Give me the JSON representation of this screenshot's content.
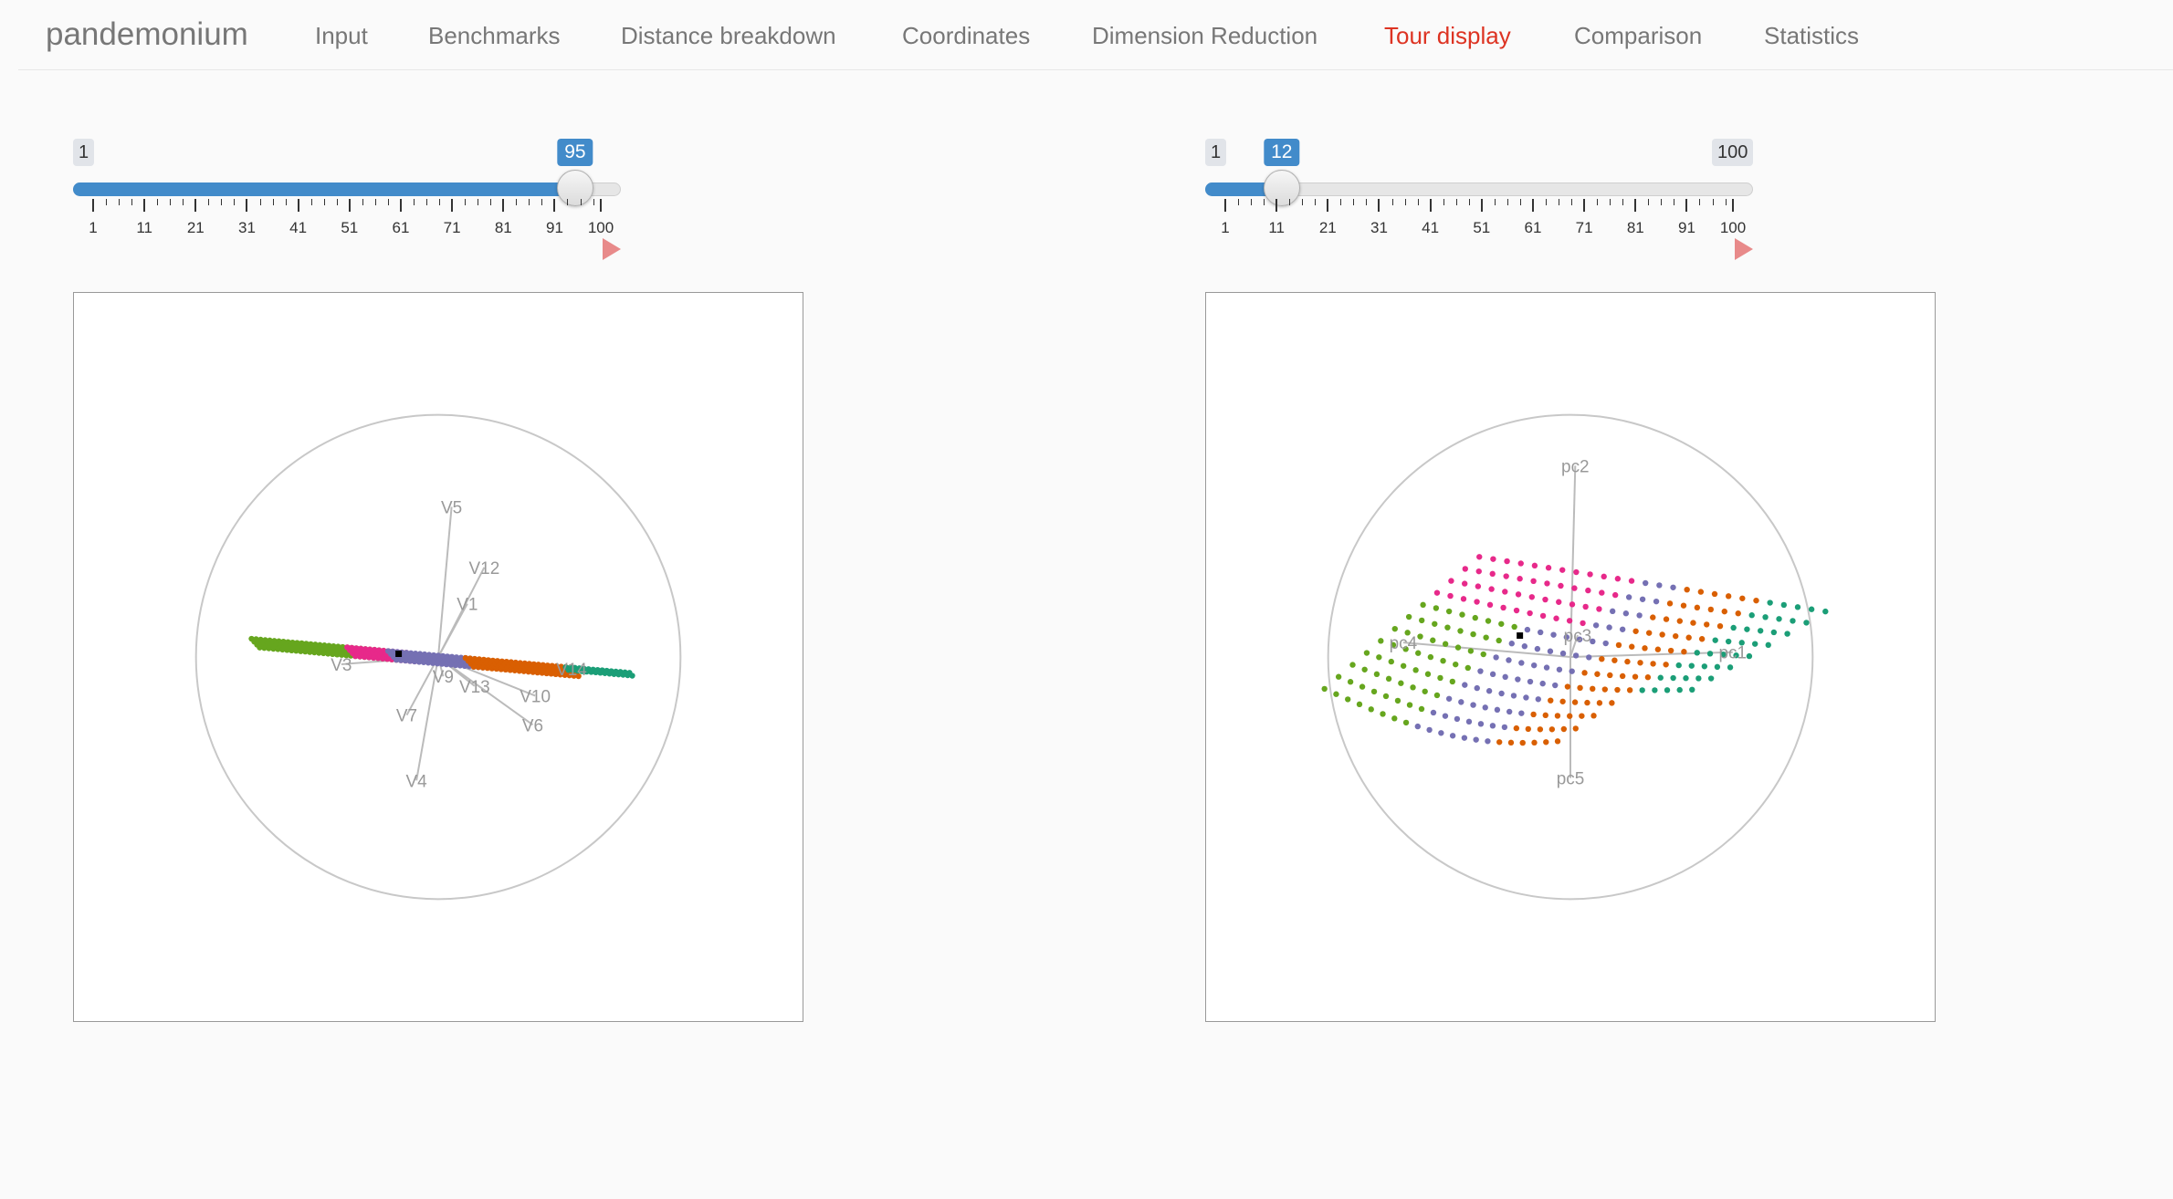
{
  "nav": {
    "brand": "pandemonium",
    "tabs": [
      {
        "label": "Input",
        "active": false
      },
      {
        "label": "Benchmarks",
        "active": false
      },
      {
        "label": "Distance breakdown",
        "active": false
      },
      {
        "label": "Coordinates",
        "active": false
      },
      {
        "label": "Dimension Reduction",
        "active": false
      },
      {
        "label": "Tour display",
        "active": true
      },
      {
        "label": "Comparison",
        "active": false
      },
      {
        "label": "Statistics",
        "active": false
      }
    ]
  },
  "sliders": [
    {
      "min_label": "1",
      "max_label": "100",
      "value": 95,
      "max_badge_visible": false,
      "tick_labels": [
        "1",
        "11",
        "21",
        "31",
        "41",
        "51",
        "61",
        "71",
        "81",
        "91",
        "100"
      ]
    },
    {
      "min_label": "1",
      "max_label": "100",
      "value": 12,
      "max_badge_visible": true,
      "tick_labels": [
        "1",
        "11",
        "21",
        "31",
        "41",
        "51",
        "61",
        "71",
        "81",
        "91",
        "100"
      ]
    }
  ],
  "colors": {
    "accent": "#428bca",
    "active_tab": "#dd3322",
    "play": "#e88a8a",
    "green": "#66a61e",
    "pink": "#e7298a",
    "purple": "#7570b3",
    "orange": "#d95f02",
    "teal": "#1b9e77",
    "axis": "#bbbbbb"
  },
  "tours": [
    {
      "axes": [
        {
          "label": "V5",
          "dx": 0.055,
          "dy": 0.62
        },
        {
          "label": "V12",
          "dx": 0.19,
          "dy": 0.37
        },
        {
          "label": "V1",
          "dx": 0.12,
          "dy": 0.22
        },
        {
          "label": "V3",
          "dx": -0.4,
          "dy": -0.03
        },
        {
          "label": "V14",
          "dx": 0.55,
          "dy": -0.05
        },
        {
          "label": "V9",
          "dx": 0.02,
          "dy": -0.08
        },
        {
          "label": "V13",
          "dx": 0.15,
          "dy": -0.12
        },
        {
          "label": "V10",
          "dx": 0.4,
          "dy": -0.16
        },
        {
          "label": "V6",
          "dx": 0.39,
          "dy": -0.28
        },
        {
          "label": "V7",
          "dx": -0.13,
          "dy": -0.24
        },
        {
          "label": "V4",
          "dx": -0.09,
          "dy": -0.51
        }
      ]
    },
    {
      "axes": [
        {
          "label": "pc2",
          "dx": 0.02,
          "dy": 0.79
        },
        {
          "label": "pc4",
          "dx": -0.69,
          "dy": 0.06
        },
        {
          "label": "pc3",
          "dx": 0.03,
          "dy": 0.09
        },
        {
          "label": "pc1",
          "dx": 0.67,
          "dy": 0.02
        },
        {
          "label": "pc5",
          "dx": 0.0,
          "dy": -0.5
        }
      ]
    }
  ]
}
